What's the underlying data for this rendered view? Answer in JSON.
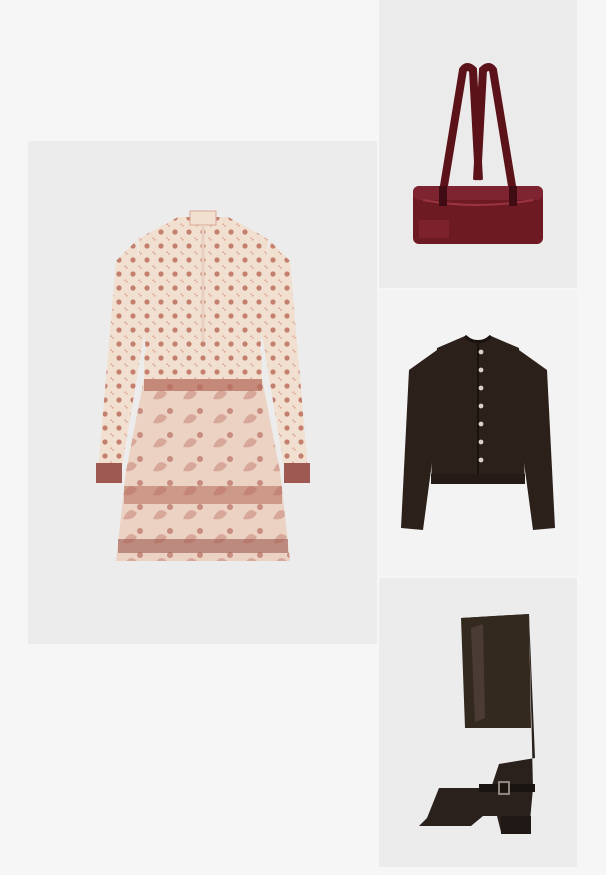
{
  "outfit": {
    "items": [
      {
        "key": "dress",
        "image": "paisley-print-mini-dress-image",
        "colors": {
          "base": "#f1dfcf",
          "print": "#b46a5a",
          "border": "#9e5a52"
        }
      },
      {
        "key": "bag",
        "image": "burgundy-shoulder-bag-image",
        "colors": {
          "base": "#6e1a22",
          "shine": "#9a3440"
        }
      },
      {
        "key": "cardigan",
        "image": "dark-brown-cardigan-image",
        "colors": {
          "base": "#2c201a",
          "buttons": "#d9d2c8"
        }
      },
      {
        "key": "boot",
        "image": "dark-brown-knee-high-boot-image",
        "colors": {
          "base": "#2a211d",
          "highlight": "#5a4a43"
        }
      }
    ]
  },
  "colors": {
    "page_background": "#f6f6f6",
    "tile_background": "#ececec"
  }
}
